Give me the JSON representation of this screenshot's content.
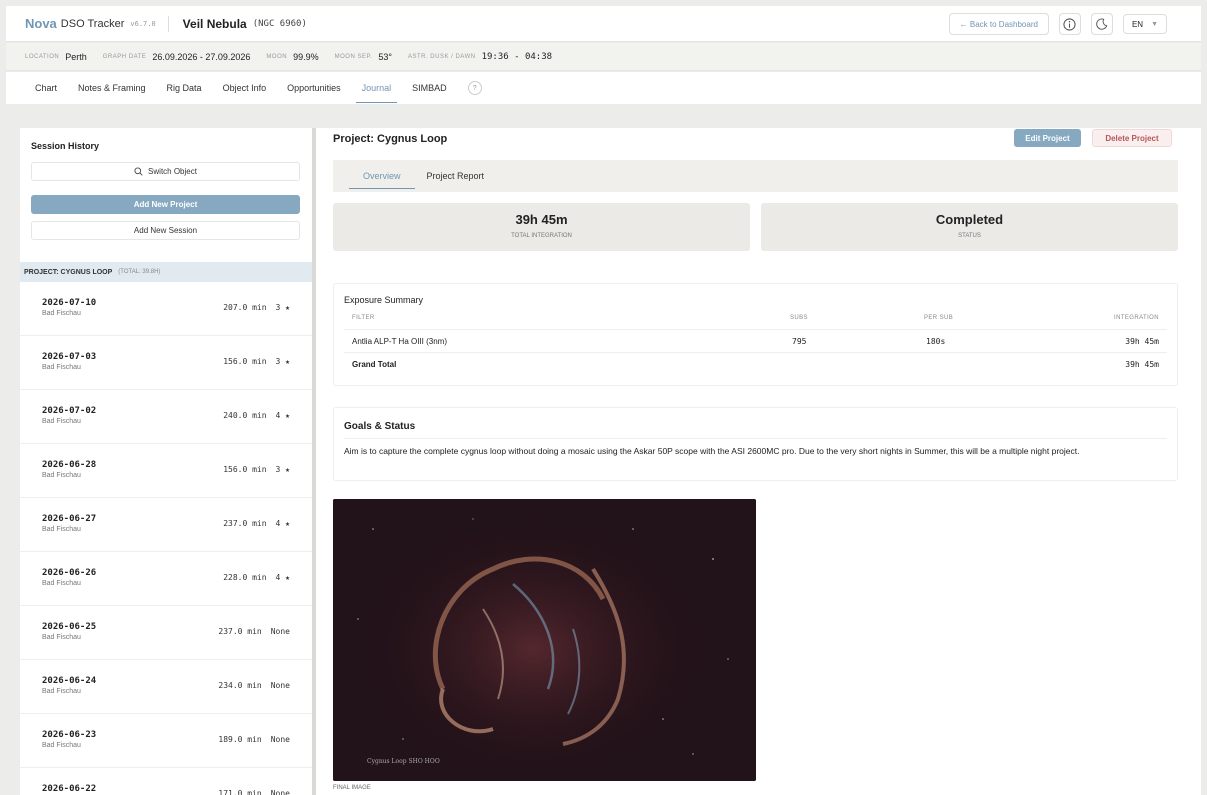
{
  "header": {
    "brand": "Nova",
    "brand_sub": "DSO Tracker",
    "version": "v6.7.0",
    "object_title": "Veil Nebula",
    "object_code": "(NGC 6960)",
    "back_label": "← Back to Dashboard",
    "lang": "EN"
  },
  "info": {
    "location_label": "LOCATION",
    "location": "Perth",
    "graph_date_label": "GRAPH DATE",
    "graph_date": "26.09.2026 - 27.09.2026",
    "moon_label": "MOON",
    "moon": "99.9%",
    "moon_sep_label": "MOON SEP.",
    "moon_sep": "53°",
    "dusk_label": "ASTR. DUSK / DAWN",
    "dusk": "19:36 - 04:38"
  },
  "tabs": [
    "Chart",
    "Notes & Framing",
    "Rig Data",
    "Object Info",
    "Opportunities",
    "Journal",
    "SIMBAD"
  ],
  "tab_help": "?",
  "sidebar": {
    "title": "Session History",
    "switch_label": "Switch Object",
    "add_project": "Add New Project",
    "add_session": "Add New Session",
    "project_header": "PROJECT: CYGNUS LOOP",
    "project_total": "(TOTAL: 39.8H)",
    "sessions": [
      {
        "date": "2026-07-10",
        "loc": "Bad Fischau",
        "min": "207.0 min",
        "rating": "3 ★"
      },
      {
        "date": "2026-07-03",
        "loc": "Bad Fischau",
        "min": "156.0 min",
        "rating": "3 ★"
      },
      {
        "date": "2026-07-02",
        "loc": "Bad Fischau",
        "min": "240.0 min",
        "rating": "4 ★"
      },
      {
        "date": "2026-06-28",
        "loc": "Bad Fischau",
        "min": "156.0 min",
        "rating": "3 ★"
      },
      {
        "date": "2026-06-27",
        "loc": "Bad Fischau",
        "min": "237.0 min",
        "rating": "4 ★"
      },
      {
        "date": "2026-06-26",
        "loc": "Bad Fischau",
        "min": "228.0 min",
        "rating": "4 ★"
      },
      {
        "date": "2026-06-25",
        "loc": "Bad Fischau",
        "min": "237.0 min",
        "rating": "None"
      },
      {
        "date": "2026-06-24",
        "loc": "Bad Fischau",
        "min": "234.0 min",
        "rating": "None"
      },
      {
        "date": "2026-06-23",
        "loc": "Bad Fischau",
        "min": "189.0 min",
        "rating": "None"
      },
      {
        "date": "2026-06-22",
        "loc": "",
        "min": "171.0 min",
        "rating": "None"
      }
    ]
  },
  "main": {
    "project_title": "Project: Cygnus Loop",
    "edit_label": "Edit Project",
    "delete_label": "Delete Project",
    "subtabs": [
      "Overview",
      "Project Report"
    ],
    "total_integration": "39h 45m",
    "total_integration_label": "TOTAL INTEGRATION",
    "status": "Completed",
    "status_label": "STATUS",
    "exposure": {
      "title": "Exposure Summary",
      "headers": [
        "FILTER",
        "SUBS",
        "PER SUB",
        "INTEGRATION"
      ],
      "row": {
        "filter": "Antlia ALP-T Ha OIII (3nm)",
        "subs": "795",
        "per_sub": "180s",
        "integration": "39h 45m"
      },
      "total_label": "Grand Total",
      "total_integration": "39h 45m"
    },
    "goals_title": "Goals & Status",
    "goals_text": "Aim is to capture the complete cygnus loop without doing a mosaic using the Askar 50P scope with the ASI 2600MC pro. Due to the very short nights in Summer, this will be a multiple night project.",
    "photo_caption_text": "Cygnus Loop SHO HOO",
    "final_image_label": "FINAL IMAGE"
  },
  "colors": {
    "accent": "#6f96b5",
    "primary_button": "#86a8c0",
    "danger": "#b45858"
  }
}
